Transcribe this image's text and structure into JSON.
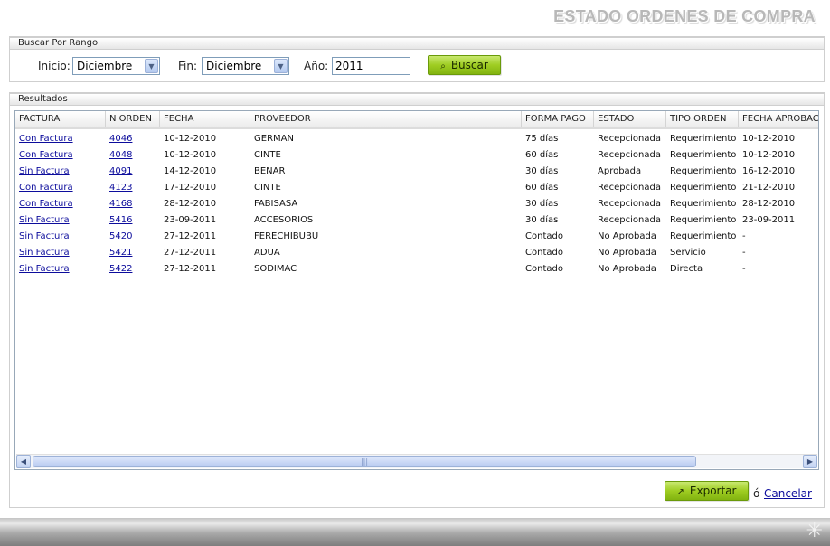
{
  "page_title": "ESTADO ORDENES DE COMPRA",
  "search": {
    "legend": "Buscar Por Rango",
    "inicio_label": "Inicio:",
    "inicio_value": "Diciembre",
    "fin_label": "Fin:",
    "fin_value": "Diciembre",
    "anio_label": "Año:",
    "anio_value": "2011",
    "buscar_label": "Buscar"
  },
  "results": {
    "legend": "Resultados",
    "columns": [
      "FACTURA",
      "N ORDEN",
      "FECHA",
      "PROVEEDOR",
      "FORMA PAGO",
      "ESTADO",
      "TIPO ORDEN",
      "FECHA APROBAC"
    ],
    "rows": [
      [
        "Con Factura",
        "4046",
        "10-12-2010",
        "GERMAN",
        "75 días",
        "Recepcionada",
        "Requerimiento",
        "10-12-2010"
      ],
      [
        "Con Factura",
        "4048",
        "10-12-2010",
        "CINTE",
        "60 días",
        "Recepcionada",
        "Requerimiento",
        "10-12-2010"
      ],
      [
        "Sin Factura",
        "4091",
        "14-12-2010",
        "BENAR",
        "30 días",
        "Aprobada",
        "Requerimiento",
        "16-12-2010"
      ],
      [
        "Con Factura",
        "4123",
        "17-12-2010",
        "CINTE",
        "60 días",
        "Recepcionada",
        "Requerimiento",
        "21-12-2010"
      ],
      [
        "Con Factura",
        "4168",
        "28-12-2010",
        "FABISASA",
        "30 días",
        "Recepcionada",
        "Requerimiento",
        "28-12-2010"
      ],
      [
        "Sin Factura",
        "5416",
        "23-09-2011",
        "ACCESORIOS",
        "30 días",
        "Recepcionada",
        "Requerimiento",
        "23-09-2011"
      ],
      [
        "Sin Factura",
        "5420",
        "27-12-2011",
        "FERECHIBUBU",
        "Contado",
        "No Aprobada",
        "Requerimiento",
        "-"
      ],
      [
        "Sin Factura",
        "5421",
        "27-12-2011",
        "ADUA",
        "Contado",
        "No Aprobada",
        "Servicio",
        "-"
      ],
      [
        "Sin Factura",
        "5422",
        "27-12-2011",
        "SODIMAC",
        "Contado",
        "No Aprobada",
        "Directa",
        "-"
      ]
    ]
  },
  "actions": {
    "exportar_label": "Exportar",
    "or_text": "ó",
    "cancelar_label": "Cancelar"
  },
  "icons": {
    "buscar": "search-icon",
    "exportar": "external-link-icon"
  },
  "colors": {
    "button_green": "#9fcd22",
    "link": "#0c0c9c",
    "title_gray": "#b8b8b8"
  }
}
